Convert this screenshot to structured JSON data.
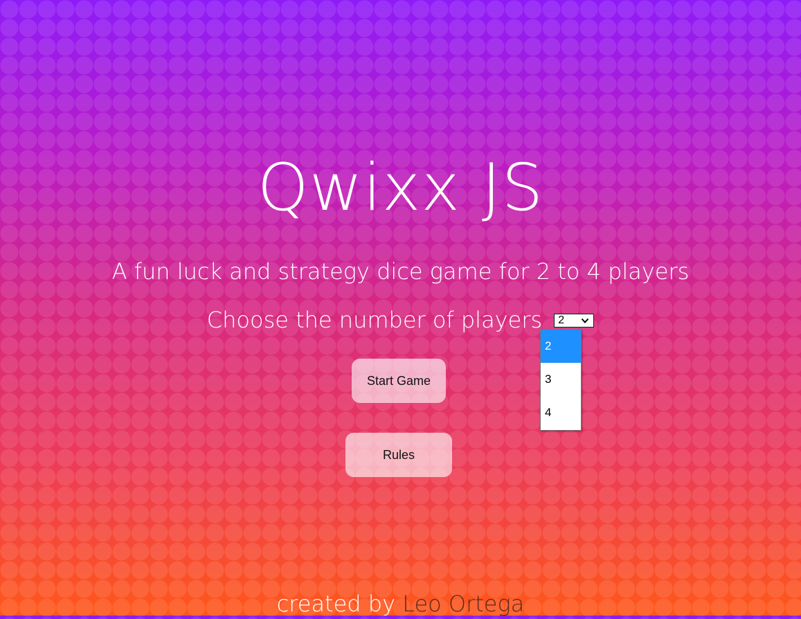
{
  "app": {
    "title": "Qwixx JS",
    "subtitle": "A fun luck and strategy dice game for 2 to 4 players"
  },
  "players": {
    "label": "Choose the number of players",
    "selected": "2",
    "options": [
      "2",
      "3",
      "4"
    ],
    "chevron_icon": "chevron-down-icon"
  },
  "buttons": {
    "start": "Start Game",
    "rules": "Rules"
  },
  "footer": {
    "prefix": "created by",
    "author": "Leo Ortega"
  },
  "colors": {
    "gradient_top": "#8e1cf7",
    "gradient_bottom": "#ff5719",
    "option_highlight": "#1e90ff",
    "author_link": "#5a2a1c"
  }
}
